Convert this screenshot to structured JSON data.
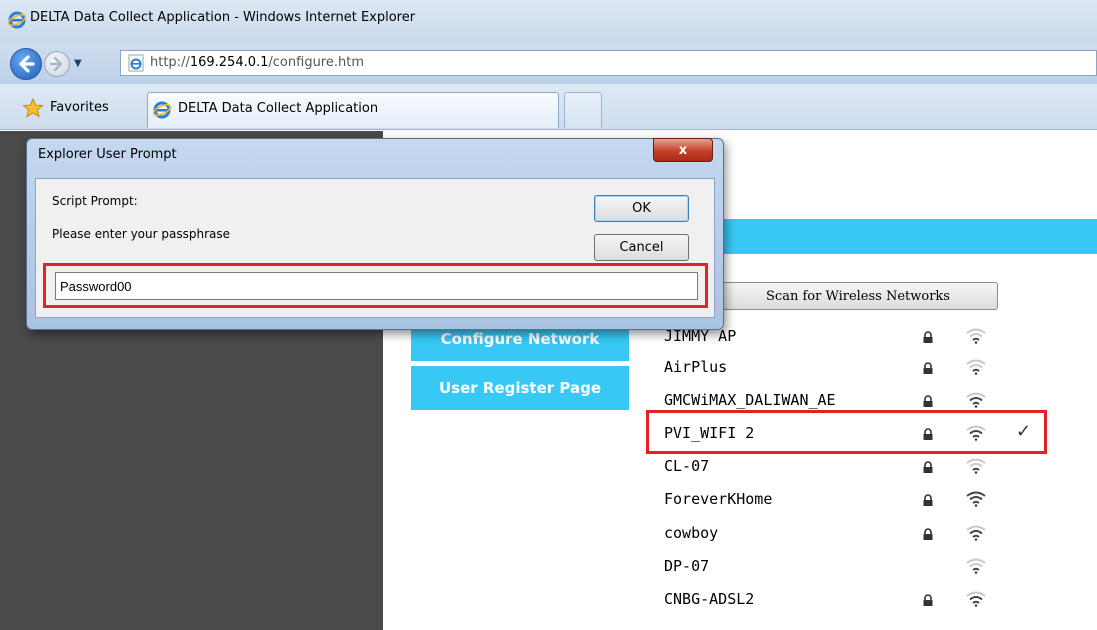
{
  "window": {
    "title": "DELTA Data Collect Application - Windows Internet Explorer"
  },
  "address_bar": {
    "url_prefix": "http://",
    "url_host": "169.254.0.1",
    "url_path": "/configure.htm"
  },
  "favorites_bar": {
    "favorites_label": "Favorites",
    "tabs": [
      {
        "label": "DELTA Data Collect Application",
        "active": true
      }
    ]
  },
  "page": {
    "scan_button_label": "Scan for Wireless Networks",
    "nav": [
      {
        "label": "Configure Network"
      },
      {
        "label": "User Register Page"
      }
    ],
    "networks": [
      {
        "ssid": "JIMMY AP",
        "locked": true,
        "signal": "weak"
      },
      {
        "ssid": "AirPlus",
        "locked": true,
        "signal": "weak"
      },
      {
        "ssid": "GMCWiMAX_DALIWAN_AE",
        "locked": true,
        "signal": "medium"
      },
      {
        "ssid": "PVI_WIFI 2",
        "locked": true,
        "signal": "medium",
        "selected": true
      },
      {
        "ssid": "CL-07",
        "locked": true,
        "signal": "weak"
      },
      {
        "ssid": "ForeverKHome",
        "locked": true,
        "signal": "strong"
      },
      {
        "ssid": "cowboy",
        "locked": true,
        "signal": "medium"
      },
      {
        "ssid": "DP-07",
        "locked": false,
        "signal": "weak"
      },
      {
        "ssid": "CNBG-ADSL2",
        "locked": true,
        "signal": "medium"
      }
    ],
    "selected_mark": "✓"
  },
  "dialog": {
    "title": "Explorer User Prompt",
    "close_label": "x",
    "heading": "Script Prompt:",
    "message": "Please enter your passphrase",
    "ok_label": "OK",
    "cancel_label": "Cancel",
    "input_value": "Password00"
  },
  "colors": {
    "accent": "#38c8f5",
    "highlight": "#e32222",
    "sidebar": "#4a4a4a"
  }
}
